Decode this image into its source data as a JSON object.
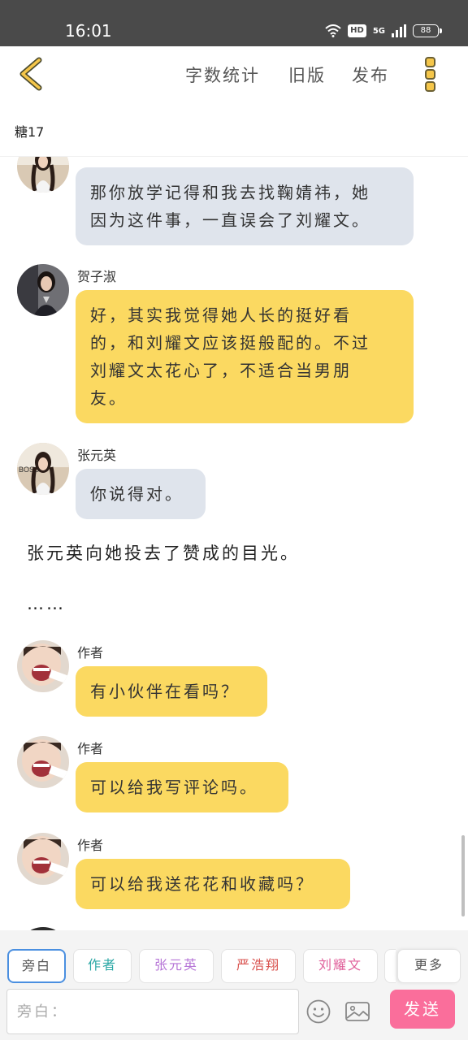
{
  "status_bar": {
    "time": "16:01",
    "hd": "HD",
    "network": "5G",
    "battery": "88",
    "icons": [
      "wifi-icon",
      "signal-icon",
      "battery-icon"
    ]
  },
  "top_bar": {
    "back_icon": "chevron-left-icon",
    "word_count": "字数统计",
    "old_version": "旧版",
    "publish": "发布",
    "menu_icon": "more-vertical-icon",
    "accent": "#f5c64a"
  },
  "sub_header": {
    "title": "糖17"
  },
  "messages": [
    {
      "speaker": "",
      "text_lines": [
        "那你放学记得和我去找鞠婧祎，她",
        "因为这件事，一直误会了刘耀文。"
      ],
      "style": "grey"
    },
    {
      "speaker": "贺子淑",
      "text_lines": [
        "好，其实我觉得她人长的挺好看",
        "的，和刘耀文应该挺般配的。不过",
        "刘耀文太花心了，不适合当男朋",
        "友。"
      ],
      "style": "yellow"
    },
    {
      "speaker": "张元英",
      "text_lines": [
        "你说得对。"
      ],
      "style": "grey"
    },
    {
      "speaker": "作者",
      "text_lines": [
        "有小伙伴在看吗？"
      ],
      "style": "yellow"
    },
    {
      "speaker": "作者",
      "text_lines": [
        "可以给我写评论吗。"
      ],
      "style": "yellow"
    },
    {
      "speaker": "作者",
      "text_lines": [
        "可以给我送花花和收藏吗？"
      ],
      "style": "yellow"
    }
  ],
  "narrations": [
    "张元英向她投去了赞成的目光。",
    "……"
  ],
  "role_chips": [
    {
      "label": "旁白",
      "color": "#555555"
    },
    {
      "label": "作者",
      "color": "#2aa7a5"
    },
    {
      "label": "张元英",
      "color": "#b574d6"
    },
    {
      "label": "严浩翔",
      "color": "#d9534f"
    },
    {
      "label": "刘耀文",
      "color": "#e0609b"
    },
    {
      "label": "更多",
      "color": "#555555"
    }
  ],
  "input": {
    "placeholder": "旁白：",
    "emoji_icon": "smiley-icon",
    "image_icon": "image-icon",
    "send_label": "发送",
    "send_color": "#fa6e9b"
  },
  "colors": {
    "bubble_grey": "#dfe4ec",
    "bubble_yellow": "#fbd961",
    "selected_chip_border": "#4a8fe0"
  }
}
